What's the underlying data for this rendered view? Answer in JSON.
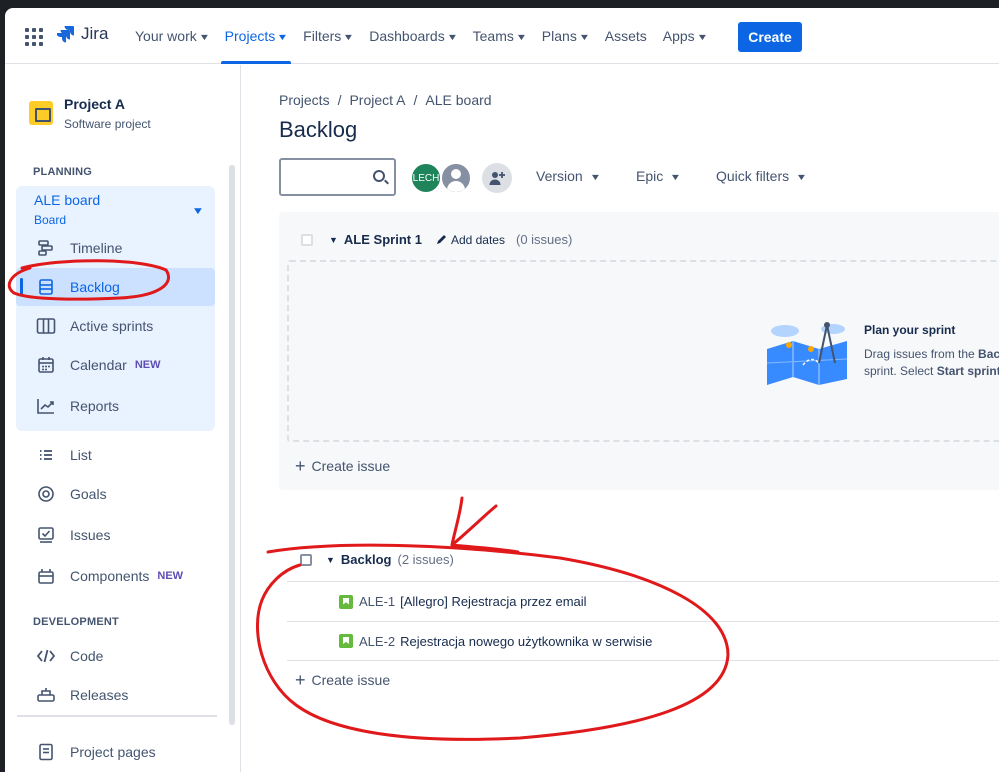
{
  "topnav": {
    "logo_text": "Jira",
    "items": [
      {
        "label": "Your work",
        "dropdown": true
      },
      {
        "label": "Projects",
        "dropdown": true,
        "active": true
      },
      {
        "label": "Filters",
        "dropdown": true
      },
      {
        "label": "Dashboards",
        "dropdown": true
      },
      {
        "label": "Teams",
        "dropdown": true
      },
      {
        "label": "Plans",
        "dropdown": true
      },
      {
        "label": "Assets",
        "dropdown": false
      },
      {
        "label": "Apps",
        "dropdown": true
      }
    ],
    "create_label": "Create"
  },
  "sidebar": {
    "project_name": "Project A",
    "project_type": "Software project",
    "planning_label": "PLANNING",
    "board_name": "ALE board",
    "board_sub": "Board",
    "board_items": [
      {
        "label": "Timeline",
        "icon": "timeline-icon"
      },
      {
        "label": "Backlog",
        "icon": "backlog-icon",
        "selected": true
      },
      {
        "label": "Active sprints",
        "icon": "board-columns-icon"
      },
      {
        "label": "Calendar",
        "icon": "calendar-icon",
        "badge": "NEW"
      },
      {
        "label": "Reports",
        "icon": "reports-icon"
      }
    ],
    "other_items": [
      {
        "label": "List",
        "icon": "list-icon"
      },
      {
        "label": "Goals",
        "icon": "goals-icon"
      },
      {
        "label": "Issues",
        "icon": "issues-icon"
      },
      {
        "label": "Components",
        "icon": "components-icon",
        "badge": "NEW"
      }
    ],
    "development_label": "DEVELOPMENT",
    "dev_items": [
      {
        "label": "Code",
        "icon": "code-icon"
      },
      {
        "label": "Releases",
        "icon": "releases-icon"
      }
    ],
    "footer_item": {
      "label": "Project pages",
      "icon": "page-icon"
    }
  },
  "main": {
    "breadcrumb": [
      "Projects",
      "/",
      "Project A",
      "/",
      "ALE board"
    ],
    "title": "Backlog",
    "search_placeholder": "",
    "avatar_initials": "LECH",
    "filters": [
      "Version",
      "Epic",
      "Quick filters"
    ],
    "sprint": {
      "name": "ALE Sprint 1",
      "add_dates": "Add dates",
      "count": "(0 issues)",
      "plan_title": "Plan your sprint",
      "plan_line1_prefix": "Drag issues from the ",
      "plan_line1_bold": "Bac",
      "plan_line2_prefix": "sprint. Select ",
      "plan_line2_bold": "Start sprint",
      "create_issue": "Create issue"
    },
    "backlog": {
      "name": "Backlog",
      "count": "(2 issues)",
      "issues": [
        {
          "key": "ALE-1",
          "summary": "[Allegro] Rejestracja przez email"
        },
        {
          "key": "ALE-2",
          "summary": "Rejestracja nowego użytkownika w serwisie"
        }
      ],
      "create_issue": "Create issue"
    }
  },
  "colors": {
    "accent": "#0c66e4",
    "annotation": "#e0191b",
    "story": "#63ba3c",
    "avatar": "#1f845a"
  }
}
